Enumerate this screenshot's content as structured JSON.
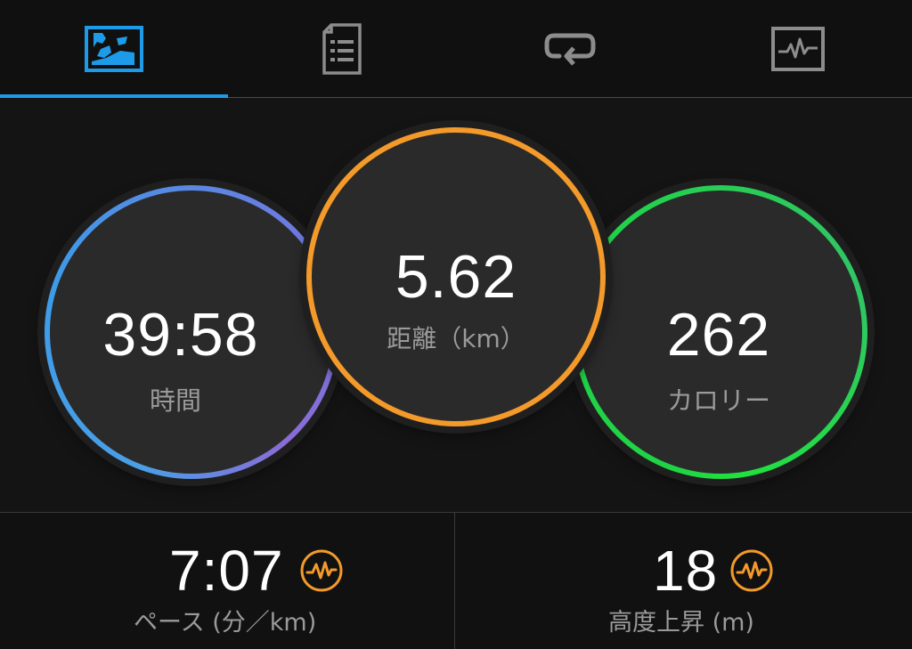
{
  "tabs": [
    {
      "icon": "summary-map-icon",
      "active": true
    },
    {
      "icon": "details-list-icon",
      "active": false
    },
    {
      "icon": "laps-loop-icon",
      "active": false
    },
    {
      "icon": "charts-waveform-icon",
      "active": false
    }
  ],
  "colors": {
    "accent": "#1d9be8",
    "time_ring": "#3d9be8",
    "time_ring_end": "#8a6bd6",
    "distance_ring": "#f39a2a",
    "calories_ring": "#22d24a",
    "badge": "#f39a2a",
    "inactive_icon": "#8c8c8c"
  },
  "rings": {
    "time": {
      "value": "39:58",
      "label": "時間"
    },
    "distance": {
      "value": "5.62",
      "label": "距離（km）"
    },
    "calories": {
      "value": "262",
      "label": "カロリー"
    }
  },
  "stats": {
    "pace": {
      "value": "7:07",
      "label": "ペース (分／km)",
      "icon": "activity-pulse-icon"
    },
    "elevation": {
      "value": "18",
      "label": "高度上昇 (m)",
      "icon": "activity-pulse-icon"
    }
  }
}
